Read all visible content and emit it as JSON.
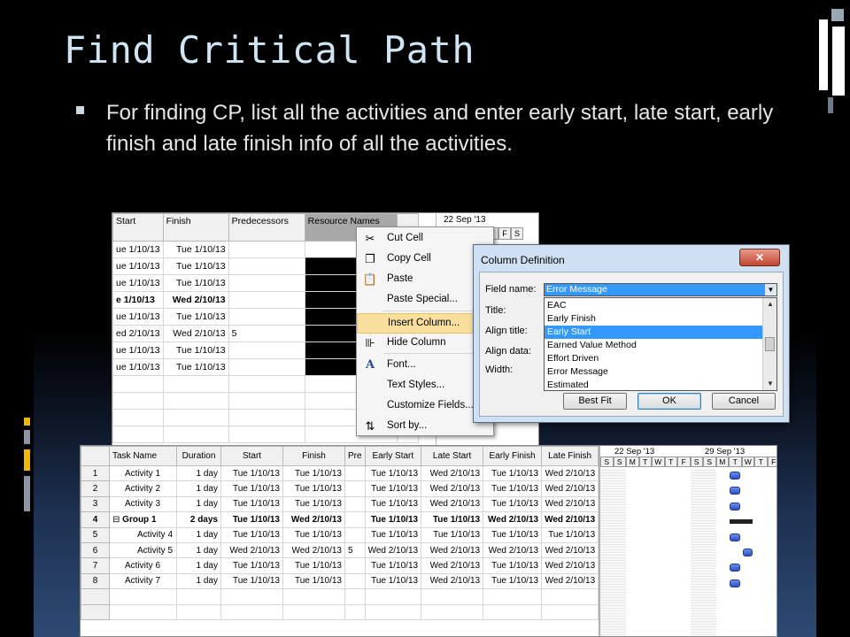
{
  "slide": {
    "title": "Find Critical Path",
    "bullet": "For finding CP, list all the activities and enter early start, late start, early finish and late finish info of all the activities."
  },
  "colors": {
    "title": "#cfe5f3",
    "text": "#e6e6e6",
    "menu_highlight": "#f8df9d",
    "selection_blue": "#3399ff",
    "gantt_bar": "#3b5fd6",
    "deco_yellow": "#f2b705",
    "deco_grey": "#8a96a3"
  },
  "screenshot1": {
    "columns": [
      "Start",
      "Finish",
      "Predecessors",
      "Resource Names"
    ],
    "rows": [
      {
        "start": "ue 1/10/13",
        "finish": "Tue 1/10/13",
        "pred": "",
        "bold": false
      },
      {
        "start": "ue 1/10/13",
        "finish": "Tue 1/10/13",
        "pred": "",
        "bold": false
      },
      {
        "start": "ue 1/10/13",
        "finish": "Tue 1/10/13",
        "pred": "",
        "bold": false
      },
      {
        "start": "e 1/10/13",
        "finish": "Wed 2/10/13",
        "pred": "",
        "bold": true
      },
      {
        "start": "ue 1/10/13",
        "finish": "Tue 1/10/13",
        "pred": "",
        "bold": false
      },
      {
        "start": "ed 2/10/13",
        "finish": "Wed 2/10/13",
        "pred": "5",
        "bold": false
      },
      {
        "start": "ue 1/10/13",
        "finish": "Tue 1/10/13",
        "pred": "",
        "bold": false
      },
      {
        "start": "ue 1/10/13",
        "finish": "Tue 1/10/13",
        "pred": "",
        "bold": false
      }
    ],
    "timeline_date": "22 Sep '13",
    "timeline_days": [
      "T",
      "F",
      "S"
    ]
  },
  "context_menu": {
    "items": [
      {
        "label": "Cut Cell",
        "icon": "scissors-icon"
      },
      {
        "label": "Copy Cell",
        "icon": "copy-icon"
      },
      {
        "label": "Paste",
        "icon": "paste-icon"
      },
      {
        "label": "Paste Special...",
        "icon": ""
      },
      {
        "label": "Insert Column...",
        "icon": "",
        "highlighted": true
      },
      {
        "label": "Hide Column",
        "icon": "hide-column-icon"
      },
      {
        "label": "Font...",
        "icon": "font-icon"
      },
      {
        "label": "Text Styles...",
        "icon": ""
      },
      {
        "label": "Customize Fields...",
        "icon": ""
      },
      {
        "label": "Sort by...",
        "icon": "sort-icon"
      }
    ]
  },
  "dialog": {
    "title": "Column Definition",
    "field_name_label": "Field name:",
    "field_name_value": "Error Message",
    "title_label": "Title:",
    "align_title_label": "Align title:",
    "align_data_label": "Align data:",
    "width_label": "Width:",
    "list_items": [
      {
        "label": "EAC",
        "selected": false
      },
      {
        "label": "Early Finish",
        "selected": false
      },
      {
        "label": "Early Start",
        "selected": true
      },
      {
        "label": "Earned Value Method",
        "selected": false
      },
      {
        "label": "Effort Driven",
        "selected": false
      },
      {
        "label": "Error Message",
        "selected": false
      },
      {
        "label": "Estimated",
        "selected": false
      }
    ],
    "best_fit_label": "Best Fit",
    "ok_label": "OK",
    "cancel_label": "Cancel"
  },
  "screenshot2": {
    "columns": [
      "Task Name",
      "Duration",
      "Start",
      "Finish",
      "Pre",
      "Early Start",
      "Late Start",
      "Early Finish",
      "Late Finish"
    ],
    "rows": [
      {
        "n": "1",
        "name": "Activity 1",
        "dur": "1 day",
        "start": "Tue 1/10/13",
        "finish": "Tue 1/10/13",
        "pre": "",
        "es": "Tue 1/10/13",
        "ls": "Wed 2/10/13",
        "ef": "Tue 1/10/13",
        "lf": "Wed 2/10/13",
        "bold": false,
        "indent": false,
        "group": false
      },
      {
        "n": "2",
        "name": "Activity 2",
        "dur": "1 day",
        "start": "Tue 1/10/13",
        "finish": "Tue 1/10/13",
        "pre": "",
        "es": "Tue 1/10/13",
        "ls": "Wed 2/10/13",
        "ef": "Tue 1/10/13",
        "lf": "Wed 2/10/13",
        "bold": false,
        "indent": false,
        "group": false
      },
      {
        "n": "3",
        "name": "Activity 3",
        "dur": "1 day",
        "start": "Tue 1/10/13",
        "finish": "Tue 1/10/13",
        "pre": "",
        "es": "Tue 1/10/13",
        "ls": "Wed 2/10/13",
        "ef": "Tue 1/10/13",
        "lf": "Wed 2/10/13",
        "bold": false,
        "indent": false,
        "group": false
      },
      {
        "n": "4",
        "name": "Group 1",
        "dur": "2 days",
        "start": "Tue 1/10/13",
        "finish": "Wed 2/10/13",
        "pre": "",
        "es": "Tue 1/10/13",
        "ls": "Tue 1/10/13",
        "ef": "Wed 2/10/13",
        "lf": "Wed 2/10/13",
        "bold": true,
        "indent": false,
        "group": true
      },
      {
        "n": "5",
        "name": "Activity 4",
        "dur": "1 day",
        "start": "Tue 1/10/13",
        "finish": "Tue 1/10/13",
        "pre": "",
        "es": "Tue 1/10/13",
        "ls": "Tue 1/10/13",
        "ef": "Tue 1/10/13",
        "lf": "Tue 1/10/13",
        "bold": false,
        "indent": true,
        "group": false
      },
      {
        "n": "6",
        "name": "Activity 5",
        "dur": "1 day",
        "start": "Wed 2/10/13",
        "finish": "Wed 2/10/13",
        "pre": "5",
        "es": "Wed 2/10/13",
        "ls": "Wed 2/10/13",
        "ef": "Wed 2/10/13",
        "lf": "Wed 2/10/13",
        "bold": false,
        "indent": true,
        "group": false
      },
      {
        "n": "7",
        "name": "Activity 6",
        "dur": "1 day",
        "start": "Tue 1/10/13",
        "finish": "Tue 1/10/13",
        "pre": "",
        "es": "Tue 1/10/13",
        "ls": "Wed 2/10/13",
        "ef": "Tue 1/10/13",
        "lf": "Wed 2/10/13",
        "bold": false,
        "indent": false,
        "group": false
      },
      {
        "n": "8",
        "name": "Activity 7",
        "dur": "1 day",
        "start": "Tue 1/10/13",
        "finish": "Tue 1/10/13",
        "pre": "",
        "es": "Tue 1/10/13",
        "ls": "Wed 2/10/13",
        "ef": "Tue 1/10/13",
        "lf": "Wed 2/10/13",
        "bold": false,
        "indent": false,
        "group": false
      }
    ],
    "timeline_weeks": [
      "22 Sep '13",
      "29 Sep '13"
    ],
    "timeline_days": [
      "S",
      "S",
      "M",
      "T",
      "W",
      "T",
      "F",
      "S",
      "S",
      "M",
      "T",
      "W",
      "T",
      "F"
    ]
  }
}
